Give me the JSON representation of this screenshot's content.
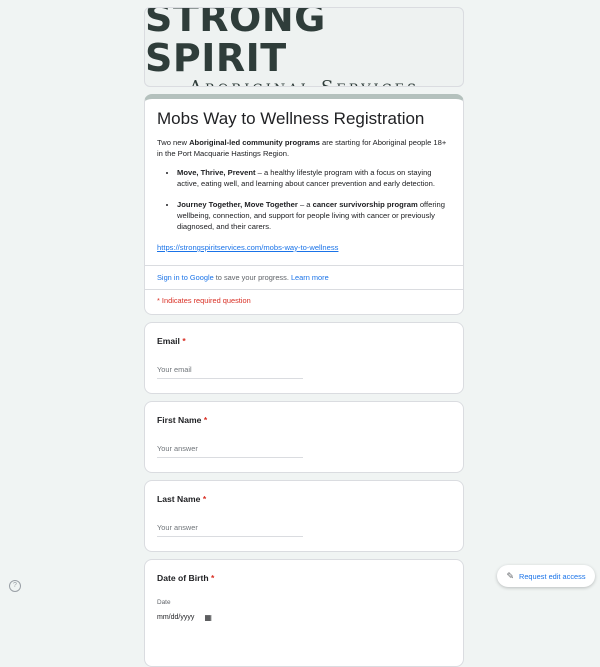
{
  "banner": {
    "title": "STRONG SPIRIT",
    "subtitle": "Aboriginal Services"
  },
  "form": {
    "title": "Mobs Way to Wellness Registration",
    "intro_prefix": "Two new ",
    "intro_bold": "Aboriginal-led community programs",
    "intro_suffix": " are starting for Aboriginal people 18+ in the Port Macquarie Hastings Region.",
    "programs": [
      {
        "name": "Move, Thrive, Prevent",
        "text": " – a healthy lifestyle program with a focus on staying active, eating well, and learning about cancer prevention and early detection."
      },
      {
        "name": "Journey Together, Move Together",
        "text_prefix": " – a ",
        "text_bold": "cancer survivorship program",
        "text_suffix": " offering wellbeing, connection, and support for people living with cancer or previously diagnosed, and their carers."
      }
    ],
    "link": "https://strongspiritservices.com/mobs-way-to-wellness"
  },
  "signin": {
    "link_text": "Sign in to Google",
    "text": " to save your progress. ",
    "learn_more": "Learn more"
  },
  "required_note": "* Indicates required question",
  "questions": {
    "email": {
      "label": "Email",
      "star": "*",
      "placeholder": "Your email"
    },
    "first_name": {
      "label": "First Name",
      "star": "*",
      "placeholder": "Your answer"
    },
    "last_name": {
      "label": "Last Name",
      "star": "*",
      "placeholder": "Your answer"
    },
    "dob": {
      "label": "Date of Birth",
      "star": "*",
      "sublabel": "Date",
      "value": "mm/dd/yyyy"
    }
  },
  "footer": {
    "help": "?",
    "edit_access": "Request edit access"
  },
  "colors": {
    "accent": "#1a73e8",
    "required": "#d93025",
    "background": "#f0f4f3",
    "header_bar": "#b4c1bd"
  }
}
